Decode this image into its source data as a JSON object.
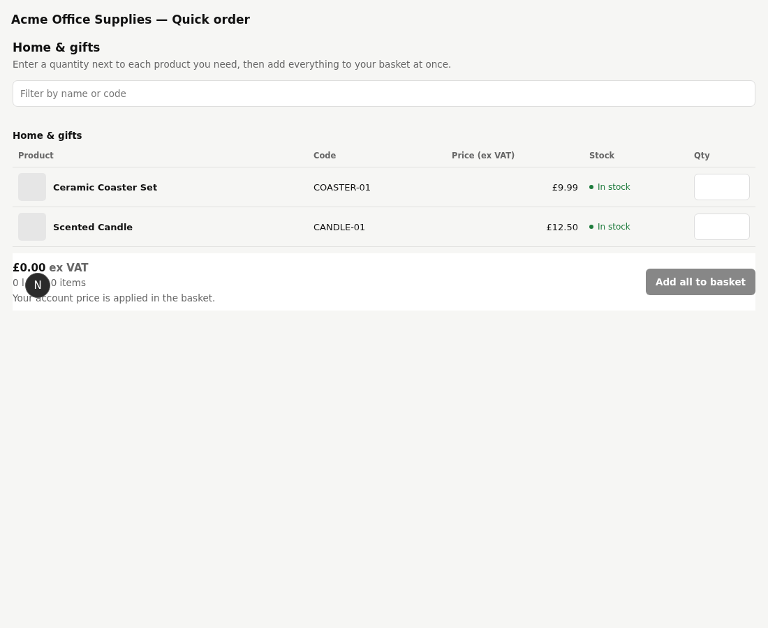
{
  "window": {
    "title": "Acme Office Supplies — Quick order"
  },
  "page": {
    "heading": "Home & gifts",
    "intro": "Enter a quantity next to each product you need, then add everything to your basket at once."
  },
  "filter": {
    "placeholder": "Filter by name or code"
  },
  "section": {
    "heading": "Home & gifts",
    "columns": [
      "Product",
      "Code",
      "Price (ex VAT)",
      "Stock",
      "Qty"
    ],
    "rows": [
      {
        "product": "Ceramic Coaster Set",
        "code": "COASTER-01",
        "price": "£9.99",
        "stock": "In stock",
        "in_stock": true
      },
      {
        "product": "Scented Candle",
        "code": "CANDLE-01",
        "price": "£12.50",
        "stock": "In stock",
        "in_stock": true
      }
    ]
  },
  "summary": {
    "total": "£0.00",
    "total_suffix": "ex VAT",
    "counts_start": "0 l",
    "counts_end": "0 items",
    "note": "Your account price is applied in the basket.",
    "button": {
      "label": "Add all to basket",
      "disabled": true
    }
  },
  "badge": {
    "label": "N"
  }
}
